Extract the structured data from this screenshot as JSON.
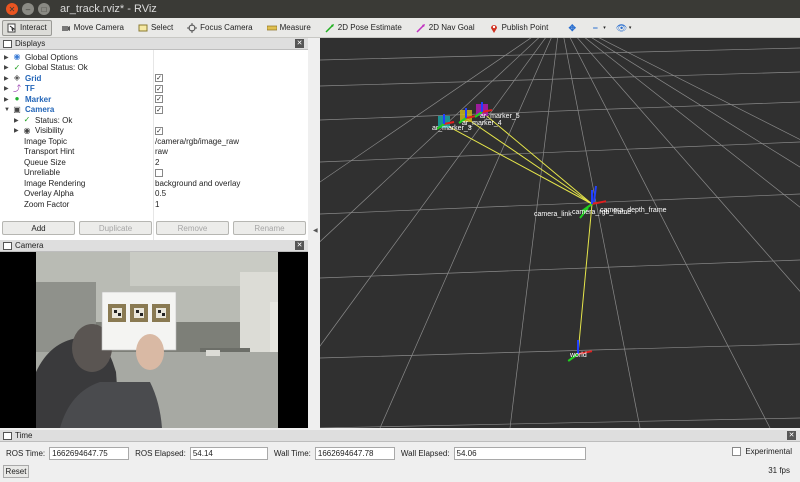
{
  "window": {
    "title": "ar_track.rviz* - RViz"
  },
  "toolbar": {
    "tools": [
      {
        "label": "Interact",
        "icon": "interact-icon",
        "active": true
      },
      {
        "label": "Move Camera",
        "icon": "move-camera-icon"
      },
      {
        "label": "Select",
        "icon": "select-icon"
      },
      {
        "label": "Focus Camera",
        "icon": "focus-camera-icon"
      },
      {
        "label": "Measure",
        "icon": "measure-icon"
      },
      {
        "label": "2D Pose Estimate",
        "icon": "pose-estimate-icon"
      },
      {
        "label": "2D Nav Goal",
        "icon": "nav-goal-icon"
      },
      {
        "label": "Publish Point",
        "icon": "publish-point-icon"
      }
    ]
  },
  "displays": {
    "title": "Displays",
    "rows": {
      "global_options": "Global Options",
      "global_status": "Global Status: Ok",
      "grid": "Grid",
      "tf": "TF",
      "marker": "Marker",
      "camera": "Camera",
      "camera_status": "Status: Ok",
      "visibility": "Visibility",
      "image_topic": "Image Topic",
      "image_topic_value": "/camera/rgb/image_raw",
      "transport_hint": "Transport Hint",
      "transport_hint_value": "raw",
      "queue_size": "Queue Size",
      "queue_size_value": "2",
      "unreliable": "Unreliable",
      "image_rendering": "Image Rendering",
      "image_rendering_value": "background and overlay",
      "overlay_alpha": "Overlay Alpha",
      "overlay_alpha_value": "0.5",
      "zoom_factor": "Zoom Factor",
      "zoom_factor_value": "1"
    },
    "checks": {
      "grid": true,
      "tf": true,
      "marker": true,
      "camera": true,
      "visibility": true,
      "unreliable": false
    },
    "buttons": {
      "add": "Add",
      "duplicate": "Duplicate",
      "remove": "Remove",
      "rename": "Rename"
    }
  },
  "camera_panel": {
    "title": "Camera"
  },
  "viewport": {
    "frame_labels": [
      "ar_marker_3",
      "ar_marker_4",
      "ar_marker_5",
      "world",
      "camera_link",
      "camera_rgb_frame",
      "camera_depth_frame"
    ],
    "colors": {
      "x_axis": "#e02020",
      "y_axis": "#20d020",
      "z_axis": "#2040ff",
      "tf_link": "#e6e64a",
      "background": "#303030",
      "grid": "#8a8a8a"
    }
  },
  "time_panel": {
    "title": "Time",
    "ros_time_label": "ROS Time:",
    "ros_time": "1662694647.75",
    "ros_elapsed_label": "ROS Elapsed:",
    "ros_elapsed": "54.14",
    "wall_time_label": "Wall Time:",
    "wall_time": "1662694647.78",
    "wall_elapsed_label": "Wall Elapsed:",
    "wall_elapsed": "54.06",
    "experimental_label": "Experimental",
    "experimental": false,
    "reset_label": "Reset",
    "fps": "31 fps"
  }
}
